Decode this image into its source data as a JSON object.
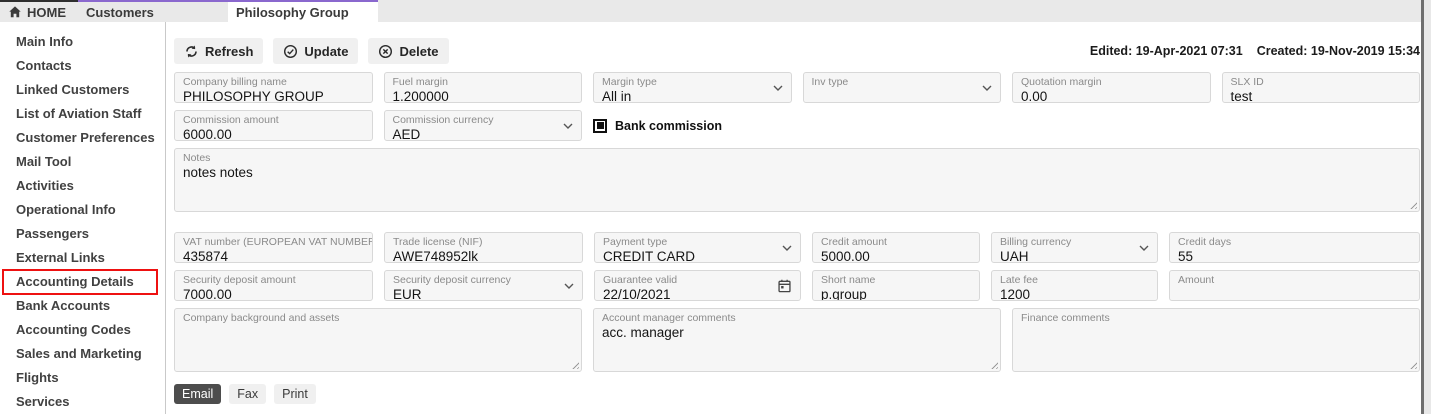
{
  "tabs": [
    {
      "label": "HOME",
      "icon": "home-icon"
    },
    {
      "label": "Customers"
    },
    {
      "label": "Philosophy Group",
      "active": true
    }
  ],
  "sidebar": {
    "items": [
      "Main Info",
      "Contacts",
      "Linked Customers",
      "List of Aviation Staff",
      "Customer Preferences",
      "Mail Tool",
      "Activities",
      "Operational Info",
      "Passengers",
      "External Links",
      "Accounting Details",
      "Bank Accounts",
      "Accounting Codes",
      "Sales and Marketing",
      "Flights",
      "Services"
    ],
    "active_item": "Accounting Details"
  },
  "toolbar": {
    "refresh_label": "Refresh",
    "update_label": "Update",
    "delete_label": "Delete",
    "edited": "Edited: 19-Apr-2021 07:31",
    "created": "Created: 19-Nov-2019 15:34"
  },
  "fields": {
    "company_billing_name": {
      "label": "Company billing name",
      "value": "PHILOSOPHY GROUP"
    },
    "fuel_margin": {
      "label": "Fuel margin",
      "value": "1.200000"
    },
    "margin_type": {
      "label": "Margin type",
      "value": "All in",
      "type": "select"
    },
    "inv_type": {
      "label": "Inv type",
      "value": "",
      "type": "select"
    },
    "quotation_margin": {
      "label": "Quotation margin",
      "value": "0.00"
    },
    "slx_id": {
      "label": "SLX ID",
      "value": "test"
    },
    "commission_amount": {
      "label": "Commission amount",
      "value": "6000.00"
    },
    "commission_currency": {
      "label": "Commission currency",
      "value": "AED",
      "type": "select"
    },
    "bank_commission": {
      "label": "Bank commission",
      "checked": true
    },
    "notes": {
      "label": "Notes",
      "value": "notes notes"
    },
    "vat_number": {
      "label": "VAT number (EUROPEAN VAT NUMBER)",
      "value": "435874"
    },
    "trade_license": {
      "label": "Trade license (NIF)",
      "value": "AWE748952lk"
    },
    "payment_type": {
      "label": "Payment type",
      "value": "CREDIT CARD",
      "type": "select"
    },
    "credit_amount": {
      "label": "Credit amount",
      "value": "5000.00"
    },
    "billing_currency": {
      "label": "Billing currency",
      "value": "UAH",
      "type": "select"
    },
    "credit_days": {
      "label": "Credit days",
      "value": "55"
    },
    "security_deposit_amount": {
      "label": "Security deposit amount",
      "value": "7000.00"
    },
    "security_deposit_currency": {
      "label": "Security deposit currency",
      "value": "EUR",
      "type": "select"
    },
    "guarantee_valid": {
      "label": "Guarantee valid",
      "value": "22/10/2021",
      "type": "date"
    },
    "short_name": {
      "label": "Short name",
      "value": "p.group"
    },
    "late_fee": {
      "label": "Late fee",
      "value": "1200"
    },
    "amount": {
      "label": "Amount",
      "value": ""
    },
    "company_background": {
      "label": "Company background and assets",
      "value": ""
    },
    "account_manager_comments": {
      "label": "Account manager comments",
      "value": "acc. manager"
    },
    "finance_comments": {
      "label": "Finance comments",
      "value": ""
    }
  },
  "footer": {
    "email_label": "Email",
    "fax_label": "Fax",
    "print_label": "Print",
    "active": "Email"
  },
  "colors": {
    "tab_accent_purple": "#8a68ce",
    "highlight_red": "#ee1111",
    "active_footer_button": "#4d4d4d"
  }
}
